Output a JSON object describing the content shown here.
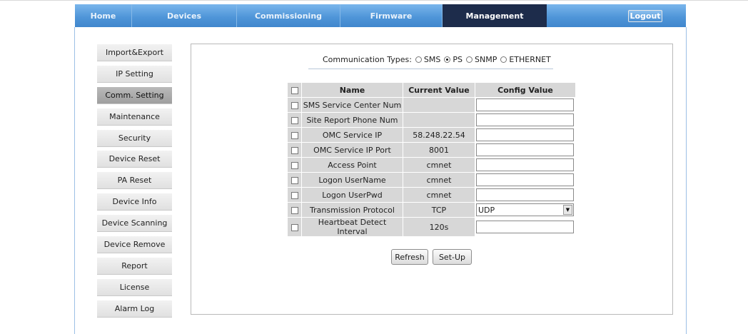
{
  "nav": {
    "tabs": [
      {
        "label": "Home"
      },
      {
        "label": "Devices"
      },
      {
        "label": "Commissioning"
      },
      {
        "label": "Firmware"
      },
      {
        "label": "Management"
      }
    ],
    "active": "Management",
    "logout_label": "Logout"
  },
  "sidebar": {
    "items": [
      {
        "label": "Import&Export"
      },
      {
        "label": "IP Setting"
      },
      {
        "label": "Comm. Setting"
      },
      {
        "label": "Maintenance"
      },
      {
        "label": "Security"
      },
      {
        "label": "Device Reset"
      },
      {
        "label": "PA Reset"
      },
      {
        "label": "Device Info"
      },
      {
        "label": "Device Scanning"
      },
      {
        "label": "Device Remove"
      },
      {
        "label": "Report"
      },
      {
        "label": "License"
      },
      {
        "label": "Alarm Log"
      }
    ],
    "active": "Comm. Setting"
  },
  "comm": {
    "label": "Communication Types:",
    "options": [
      {
        "label": "SMS",
        "checked": false
      },
      {
        "label": "PS",
        "checked": true
      },
      {
        "label": "SNMP",
        "checked": false
      },
      {
        "label": "ETHERNET",
        "checked": false
      }
    ]
  },
  "table": {
    "headers": {
      "name": "Name",
      "current": "Current Value",
      "config": "Config Value"
    },
    "rows": [
      {
        "name": "SMS Service Center Num",
        "current": "",
        "config": "",
        "current_blank": true
      },
      {
        "name": "Site Report Phone Num",
        "current": "",
        "config": "",
        "current_blank": true
      },
      {
        "name": "OMC Service IP",
        "current": "58.248.22.54",
        "config": ""
      },
      {
        "name": "OMC Service IP Port",
        "current": "8001",
        "config": ""
      },
      {
        "name": "Access Point",
        "current": "cmnet",
        "config": ""
      },
      {
        "name": "Logon UserName",
        "current": "cmnet",
        "config": ""
      },
      {
        "name": "Logon UserPwd",
        "current": "cmnet",
        "config": ""
      },
      {
        "name": "Transmission Protocol",
        "current": "TCP",
        "config": "UDP",
        "select": true
      },
      {
        "name": "Heartbeat Detect Interval",
        "current": "120s",
        "config": ""
      }
    ]
  },
  "actions": {
    "refresh": "Refresh",
    "setup": "Set-Up"
  },
  "icons": {
    "dropdown": "chevron-down-icon"
  },
  "colors": {
    "nav_bg": "#4f95d8",
    "nav_active": "#1d2c4b",
    "sidebar_active": "#a9a9a9"
  }
}
